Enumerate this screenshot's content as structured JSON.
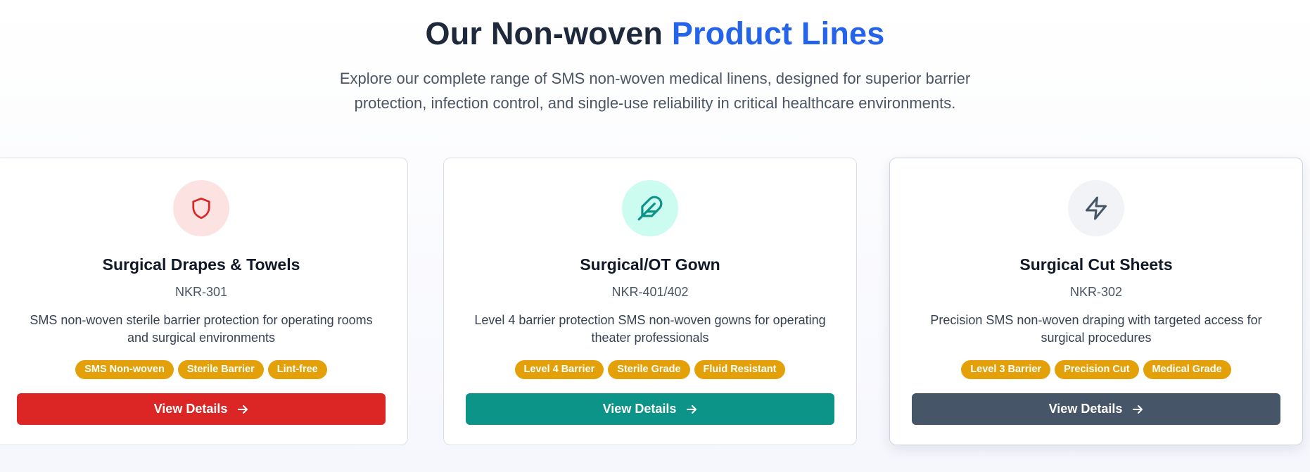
{
  "header": {
    "title_main": "Our Non-woven ",
    "title_accent": "Product Lines",
    "subtitle": "Explore our complete range of SMS non-woven medical linens, designed for superior barrier protection, infection control, and single-use reliability in critical healthcare environments."
  },
  "colors": {
    "title": "#1e293b",
    "accent": "#2563eb",
    "tag": "#e3a008"
  },
  "products": [
    {
      "icon": "shield-icon",
      "icon_bg": "#fde2e2",
      "icon_color": "#dc2626",
      "title": "Surgical Drapes & Towels",
      "code": "NKR-301",
      "description": "SMS non-woven sterile barrier protection for operating rooms and surgical environments",
      "tags": [
        "SMS Non-woven",
        "Sterile Barrier",
        "Lint-free"
      ],
      "button_label": "View Details",
      "button_color": "#dc2626"
    },
    {
      "icon": "feather-icon",
      "icon_bg": "#ccfbef",
      "icon_color": "#0d9488",
      "title": "Surgical/OT Gown",
      "code": "NKR-401/402",
      "description": "Level 4 barrier protection SMS non-woven gowns for operating theater professionals",
      "tags": [
        "Level 4 Barrier",
        "Sterile Grade",
        "Fluid Resistant"
      ],
      "button_label": "View Details",
      "button_color": "#0d9488"
    },
    {
      "icon": "lightning-icon",
      "icon_bg": "#f1f3f6",
      "icon_color": "#475569",
      "title": "Surgical Cut Sheets",
      "code": "NKR-302",
      "description": "Precision SMS non-woven draping with targeted access for surgical procedures",
      "tags": [
        "Level 3 Barrier",
        "Precision Cut",
        "Medical Grade"
      ],
      "button_label": "View Details",
      "button_color": "#475569"
    }
  ]
}
